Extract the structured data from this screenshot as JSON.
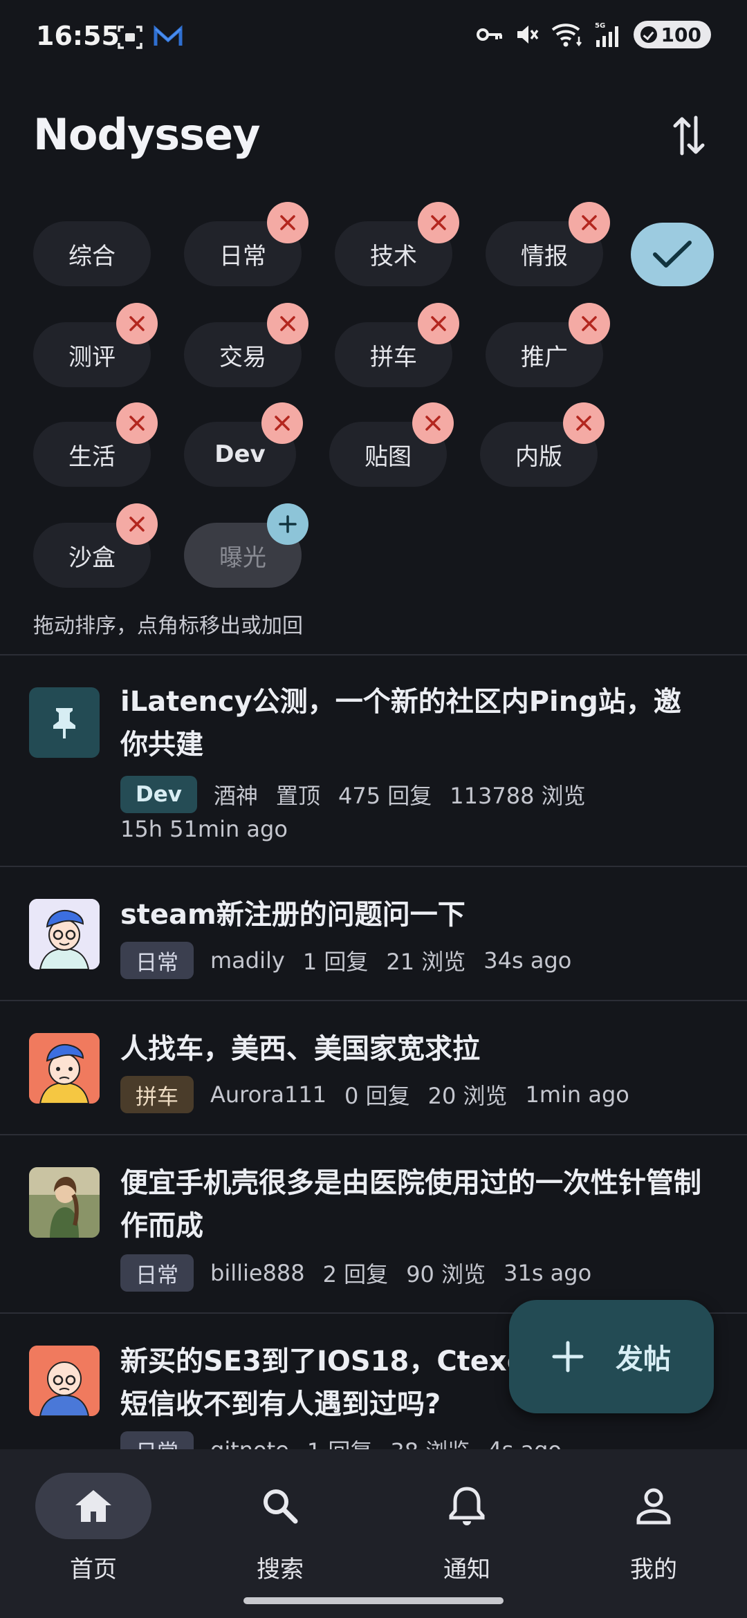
{
  "status_bar": {
    "time": "16:55",
    "battery": "100",
    "icons": [
      "screenshot-icon",
      "mail-icon",
      "key-icon",
      "mute-icon",
      "wifi-icon",
      "signal-icon"
    ]
  },
  "header": {
    "title": "Nodyssey",
    "sort_icon": "sort-arrows-icon"
  },
  "categories": [
    {
      "label": "综合",
      "removable": false
    },
    {
      "label": "日常",
      "removable": true
    },
    {
      "label": "技术",
      "removable": true
    },
    {
      "label": "情报",
      "removable": true
    },
    {
      "label": "测评",
      "removable": true
    },
    {
      "label": "交易",
      "removable": true
    },
    {
      "label": "拼车",
      "removable": true
    },
    {
      "label": "推广",
      "removable": true
    },
    {
      "label": "生活",
      "removable": true
    },
    {
      "label": "Dev",
      "removable": true
    },
    {
      "label": "贴图",
      "removable": true
    },
    {
      "label": "内版",
      "removable": true
    },
    {
      "label": "沙盒",
      "removable": true
    },
    {
      "label": "曝光",
      "removable": false,
      "hidden": true
    }
  ],
  "hint": "拖动排序，点角标移出或加回",
  "posts": [
    {
      "title": "iLatency公测，一个新的社区内Ping站，邀你共建",
      "tag": "Dev",
      "author": "酒神",
      "pinned_label": "置顶",
      "replies": "475 回复",
      "views": "113788 浏览",
      "time": "15h 51min ago",
      "avatar": "pin-icon"
    },
    {
      "title": "steam新注册的问题问一下",
      "tag": "日常",
      "author": "madily",
      "replies": "1 回复",
      "views": "21 浏览",
      "time": "34s ago",
      "avatar": "avatar-blue-hair"
    },
    {
      "title": "人找车，美西、美国家宽求拉",
      "tag": "拼车",
      "author": "Aurora111",
      "replies": "0 回复",
      "views": "20 浏览",
      "time": "1min ago",
      "avatar": "avatar-red-bg"
    },
    {
      "title": "便宜手机壳很多是由医院使用过的一次性针管制作而成",
      "tag": "日常",
      "author": "billie888",
      "replies": "2 回复",
      "views": "90 浏览",
      "time": "31s ago",
      "avatar": "avatar-illustration"
    },
    {
      "title": "新买的SE3到了IOS18，Ctexo 但是短信收不到有人遇到过吗?",
      "tag": "日常",
      "author": "gitnote",
      "replies": "1 回复",
      "views": "38 浏览",
      "time": "4s ago",
      "avatar": "avatar-bald-man"
    }
  ],
  "fab": {
    "label": "发帖"
  },
  "nav": [
    {
      "label": "首页",
      "icon": "home-icon",
      "active": true
    },
    {
      "label": "搜索",
      "icon": "search-icon",
      "active": false
    },
    {
      "label": "通知",
      "icon": "bell-icon",
      "active": false
    },
    {
      "label": "我的",
      "icon": "person-icon",
      "active": false
    }
  ],
  "colors": {
    "background": "#14161b",
    "chip": "#21232a",
    "remove_badge": "#f4aaa4",
    "add_badge": "#8dc4d8",
    "confirm": "#9ccbe0",
    "fab": "#234b54"
  }
}
